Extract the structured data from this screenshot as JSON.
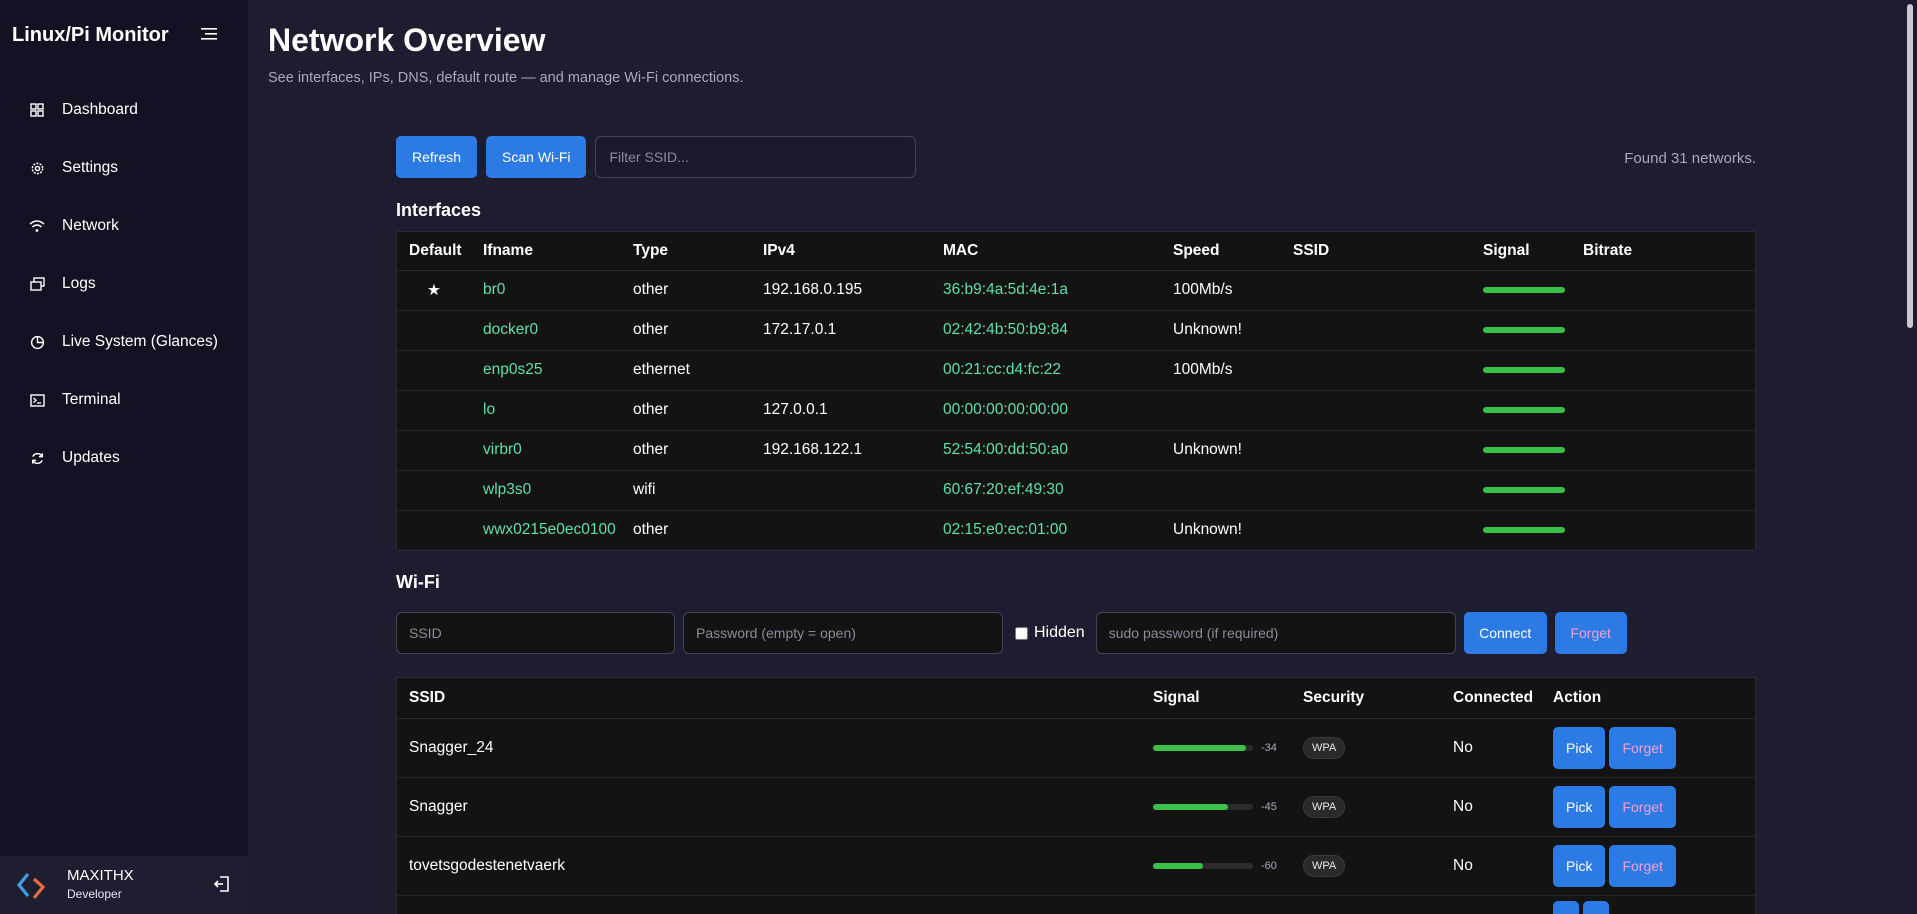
{
  "app": {
    "brand": "Linux/Pi Monitor"
  },
  "sidebar": {
    "items": [
      {
        "label": "Dashboard",
        "icon": "grid-icon"
      },
      {
        "label": "Settings",
        "icon": "gear-icon"
      },
      {
        "label": "Network",
        "icon": "wifi-icon"
      },
      {
        "label": "Logs",
        "icon": "windows-icon"
      },
      {
        "label": "Live System (Glances)",
        "icon": "pie-chart-icon"
      },
      {
        "label": "Terminal",
        "icon": "terminal-icon"
      },
      {
        "label": "Updates",
        "icon": "refresh-icon"
      }
    ],
    "user": {
      "name": "MAXITHX",
      "role": "Developer"
    }
  },
  "header": {
    "title": "Network Overview",
    "subtitle": "See interfaces, IPs, DNS, default route — and manage Wi-Fi connections."
  },
  "toolbar": {
    "refresh_label": "Refresh",
    "scan_label": "Scan Wi-Fi",
    "filter_placeholder": "Filter SSID...",
    "found_text": "Found 31 networks."
  },
  "interfaces": {
    "title": "Interfaces",
    "columns": [
      "Default",
      "Ifname",
      "Type",
      "IPv4",
      "MAC",
      "Speed",
      "SSID",
      "Signal",
      "Bitrate"
    ],
    "rows": [
      {
        "default": "★",
        "ifname": "br0",
        "type": "other",
        "ipv4": "192.168.0.195",
        "mac": "36:b9:4a:5d:4e:1a",
        "speed": "100Mb/s",
        "ssid": "",
        "bitrate": ""
      },
      {
        "default": "",
        "ifname": "docker0",
        "type": "other",
        "ipv4": "172.17.0.1",
        "mac": "02:42:4b:50:b9:84",
        "speed": "Unknown!",
        "ssid": "",
        "bitrate": ""
      },
      {
        "default": "",
        "ifname": "enp0s25",
        "type": "ethernet",
        "ipv4": "",
        "mac": "00:21:cc:d4:fc:22",
        "speed": "100Mb/s",
        "ssid": "",
        "bitrate": ""
      },
      {
        "default": "",
        "ifname": "lo",
        "type": "other",
        "ipv4": "127.0.0.1",
        "mac": "00:00:00:00:00:00",
        "speed": "",
        "ssid": "",
        "bitrate": ""
      },
      {
        "default": "",
        "ifname": "virbr0",
        "type": "other",
        "ipv4": "192.168.122.1",
        "mac": "52:54:00:dd:50:a0",
        "speed": "Unknown!",
        "ssid": "",
        "bitrate": ""
      },
      {
        "default": "",
        "ifname": "wlp3s0",
        "type": "wifi",
        "ipv4": "",
        "mac": "60:67:20:ef:49:30",
        "speed": "",
        "ssid": "",
        "bitrate": ""
      },
      {
        "default": "",
        "ifname": "wwx0215e0ec0100",
        "type": "other",
        "ipv4": "",
        "mac": "02:15:e0:ec:01:00",
        "speed": "Unknown!",
        "ssid": "",
        "bitrate": ""
      }
    ]
  },
  "wifi": {
    "title": "Wi-Fi",
    "ssid_placeholder": "SSID",
    "password_placeholder": "Password (empty = open)",
    "hidden_label": "Hidden",
    "sudo_placeholder": "sudo password (if required)",
    "connect_label": "Connect",
    "forget_label": "Forget",
    "columns": [
      "SSID",
      "Signal",
      "Security",
      "Connected",
      "Action"
    ],
    "networks": [
      {
        "ssid": "Snagger_24",
        "signal": -34,
        "signal_pct": 0.93,
        "security": "WPA",
        "connected": "No",
        "pick": "Pick",
        "forget": "Forget"
      },
      {
        "ssid": "Snagger",
        "signal": -45,
        "signal_pct": 0.75,
        "security": "WPA",
        "connected": "No",
        "pick": "Pick",
        "forget": "Forget"
      },
      {
        "ssid": "tovetsgodestenetvaerk",
        "signal": -60,
        "signal_pct": 0.5,
        "security": "WPA",
        "connected": "No",
        "pick": "Pick",
        "forget": "Forget"
      }
    ]
  },
  "colors": {
    "accent": "#2c7be5",
    "signal": "#3bc14a",
    "mono_green": "#5fe0a8",
    "forget_text": "#f29fd4"
  }
}
